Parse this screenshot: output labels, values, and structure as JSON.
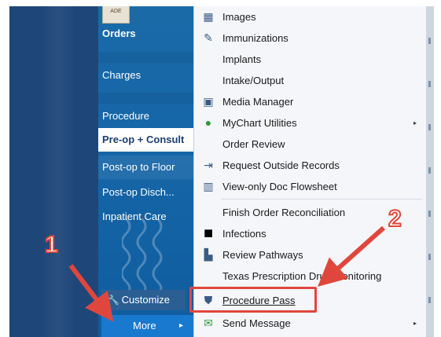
{
  "sidebar": {
    "logo_text": "ADE",
    "items": [
      {
        "label": "Orders"
      },
      {
        "label": "Charges"
      },
      {
        "label": "Procedure"
      },
      {
        "label": "Pre-op + Consult"
      },
      {
        "label": "Post-op to Floor"
      },
      {
        "label": "Post-op Disch..."
      },
      {
        "label": "Inpatient Care"
      }
    ],
    "customize_label": "Customize",
    "more_label": "More",
    "more_arrow": "▸"
  },
  "menu": {
    "items": [
      {
        "label": "Images",
        "icon": "images-icon",
        "glyph": "▦"
      },
      {
        "label": "Immunizations",
        "icon": "syringe-icon",
        "glyph": "✎"
      },
      {
        "label": "Implants",
        "icon": "",
        "glyph": ""
      },
      {
        "label": "Intake/Output",
        "icon": "",
        "glyph": ""
      },
      {
        "label": "Media Manager",
        "icon": "media-manager-icon",
        "glyph": "▣"
      },
      {
        "label": "MyChart Utilities",
        "icon": "globe-icon",
        "glyph": "●",
        "submenu": true
      },
      {
        "label": "Order Review",
        "icon": "",
        "glyph": ""
      },
      {
        "label": "Request Outside Records",
        "icon": "request-records-icon",
        "glyph": "⇥"
      },
      {
        "label": "View-only Doc Flowsheet",
        "icon": "flowsheet-icon",
        "glyph": "▥"
      },
      {
        "label": "Finish Order Reconciliation",
        "icon": "",
        "glyph": ""
      },
      {
        "label": "Infections",
        "icon": "infections-icon",
        "glyph": "■"
      },
      {
        "label": "Review Pathways",
        "icon": "pathways-icon",
        "glyph": "▙"
      },
      {
        "label": "Texas Prescription Drug Monitoring",
        "icon": "",
        "glyph": ""
      },
      {
        "label": "Procedure Pass",
        "icon": "shield-icon",
        "glyph": "⛊"
      },
      {
        "label": "Send Message",
        "icon": "send-message-icon",
        "glyph": "✉",
        "submenu": true
      }
    ],
    "submenu_arrow": "▸"
  },
  "annotations": {
    "step1": "1",
    "step2": "2",
    "highlight_color": "#e0473c"
  },
  "colors": {
    "sidebar_bg": "#1566a7",
    "menu_bg": "#f4f6f9",
    "more_button": "#1979cf"
  }
}
